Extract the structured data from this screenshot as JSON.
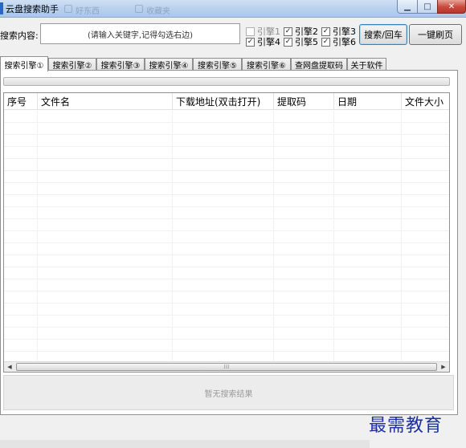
{
  "window": {
    "title": "云盘搜索助手"
  },
  "titlebar_ghost": [
    "好东西",
    "收藏夹"
  ],
  "search": {
    "label": "搜索内容:",
    "placeholder": "(请输入关键字,记得勾选右边)"
  },
  "engines": [
    {
      "label": "引擎1",
      "checked": false,
      "enabled": false
    },
    {
      "label": "引擎2",
      "checked": true,
      "enabled": true
    },
    {
      "label": "引擎3",
      "checked": true,
      "enabled": true
    },
    {
      "label": "引擎4",
      "checked": true,
      "enabled": true
    },
    {
      "label": "引擎5",
      "checked": true,
      "enabled": true
    },
    {
      "label": "引擎6",
      "checked": true,
      "enabled": true
    }
  ],
  "buttons": {
    "search": "搜索/回车",
    "refresh": "一键刷页"
  },
  "tabs": [
    "搜索引擎①",
    "搜索引擎②",
    "搜索引擎③",
    "搜索引擎④",
    "搜索引擎⑤",
    "搜索引擎⑥",
    "查网盘提取码",
    "关于软件"
  ],
  "active_tab": 0,
  "progress": 0,
  "table": {
    "columns": [
      "序号",
      "文件名",
      "下载地址(双击打开)",
      "提取码",
      "日期",
      "文件大小"
    ],
    "rows": []
  },
  "scrollbar": {
    "grip": "⁞⁞⁞"
  },
  "status": {
    "empty_text": "暂无搜索结果"
  },
  "watermark": "最需教育",
  "colors": {
    "titlebar": "#b9d1ee",
    "close_button": "#c8483a",
    "watermark": "#1c2fa0"
  }
}
